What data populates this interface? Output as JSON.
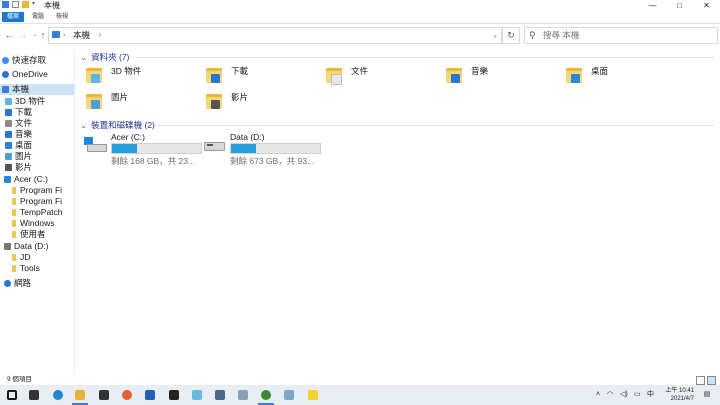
{
  "window": {
    "title": "本機",
    "controls": [
      "minimize",
      "maximize",
      "close"
    ]
  },
  "ribbon": {
    "tabs": [
      "檔案",
      "電腦",
      "檢視"
    ]
  },
  "addressbar": {
    "crumb": "本機",
    "search_placeholder": "搜尋 本機"
  },
  "sidebar": {
    "items": [
      {
        "label": "快速存取",
        "icon": "star-icon",
        "color": "#3a8ee6"
      },
      {
        "label": "OneDrive",
        "icon": "cloud-icon",
        "color": "#2a74d5"
      },
      {
        "label": "本機",
        "icon": "computer-icon",
        "color": "#3b7dd8",
        "selected": true
      },
      {
        "label": "3D 物件",
        "icon": "cube-icon",
        "color": "#5bb5e8"
      },
      {
        "label": "下載",
        "icon": "download-icon",
        "color": "#2a74d5"
      },
      {
        "label": "文件",
        "icon": "document-icon",
        "color": "#8a8a8a"
      },
      {
        "label": "音樂",
        "icon": "music-icon",
        "color": "#2a74d5"
      },
      {
        "label": "桌面",
        "icon": "desktop-icon",
        "color": "#2a86d8"
      },
      {
        "label": "圖片",
        "icon": "picture-icon",
        "color": "#4aa0d8"
      },
      {
        "label": "影片",
        "icon": "video-icon",
        "color": "#555555"
      },
      {
        "label": "Acer (C:)",
        "icon": "drive-c-icon",
        "color": "#2a86d8"
      },
      {
        "label": "Program Fi",
        "icon": "folder-icon",
        "color": "#f0c454"
      },
      {
        "label": "Program Fi",
        "icon": "folder-icon",
        "color": "#f0c454"
      },
      {
        "label": "TempPatch",
        "icon": "folder-icon",
        "color": "#f0c454"
      },
      {
        "label": "Windows",
        "icon": "folder-icon",
        "color": "#f0c454"
      },
      {
        "label": "使用者",
        "icon": "folder-icon",
        "color": "#f0c454"
      },
      {
        "label": "Data (D:)",
        "icon": "drive-d-icon",
        "color": "#777777"
      },
      {
        "label": "JD",
        "icon": "folder-icon",
        "color": "#f0c454"
      },
      {
        "label": "Tools",
        "icon": "folder-icon",
        "color": "#f0c454"
      },
      {
        "label": "網路",
        "icon": "network-icon",
        "color": "#2a74d5"
      }
    ]
  },
  "folders_group": {
    "title": "資料夾 (7)",
    "items": [
      {
        "name": "3D 物件",
        "icon": "cube-icon",
        "badge_color": "#5bb5e8"
      },
      {
        "name": "下載",
        "icon": "download-icon",
        "badge_color": "#2a74d5"
      },
      {
        "name": "文件",
        "icon": "document-icon",
        "badge_color": "#e8e8e8"
      },
      {
        "name": "音樂",
        "icon": "music-icon",
        "badge_color": "#2a74d5"
      },
      {
        "name": "桌面",
        "icon": "desktop-icon",
        "badge_color": "#2a86d8"
      },
      {
        "name": "圖片",
        "icon": "picture-icon",
        "badge_color": "#4aa0d8"
      },
      {
        "name": "影片",
        "icon": "video-icon",
        "badge_color": "#555555"
      }
    ]
  },
  "drives_group": {
    "title": "裝置和磁碟機 (2)",
    "items": [
      {
        "name": "Acer (C:)",
        "free_text": "剩餘 168 GB，共 23...",
        "used_fraction": 0.28,
        "icon": "windows-drive-icon"
      },
      {
        "name": "Data (D:)",
        "free_text": "剩餘 673 GB，共 93...",
        "used_fraction": 0.28,
        "icon": "hard-drive-icon"
      }
    ]
  },
  "statusbar": {
    "count": "9 個項目"
  },
  "taskbar": {
    "apps": [
      {
        "icon": "start-icon",
        "color": "#1a1a1a"
      },
      {
        "icon": "task-view-icon",
        "color": "#333333"
      },
      {
        "icon": "edge-icon",
        "color": "#1e88d6"
      },
      {
        "icon": "file-explorer-icon",
        "color": "#e9b23a"
      },
      {
        "icon": "store-icon",
        "color": "#333333"
      },
      {
        "icon": "firefox-icon",
        "color": "#e66030"
      },
      {
        "icon": "dropbox-icon",
        "color": "#1f5fb8"
      },
      {
        "icon": "notion-icon",
        "color": "#222222"
      },
      {
        "icon": "app-icon",
        "color": "#6ab7e0"
      },
      {
        "icon": "calculator-icon",
        "color": "#4a6a8a"
      },
      {
        "icon": "mail-icon",
        "color": "#8aa0b4"
      },
      {
        "icon": "globe-icon",
        "color": "#3a8a3a"
      },
      {
        "icon": "app-icon",
        "color": "#7fa6c8"
      },
      {
        "icon": "sticky-icon",
        "color": "#f2d22e"
      }
    ],
    "clock_time": "上午 10:41",
    "clock_date": "2021/4/7"
  }
}
